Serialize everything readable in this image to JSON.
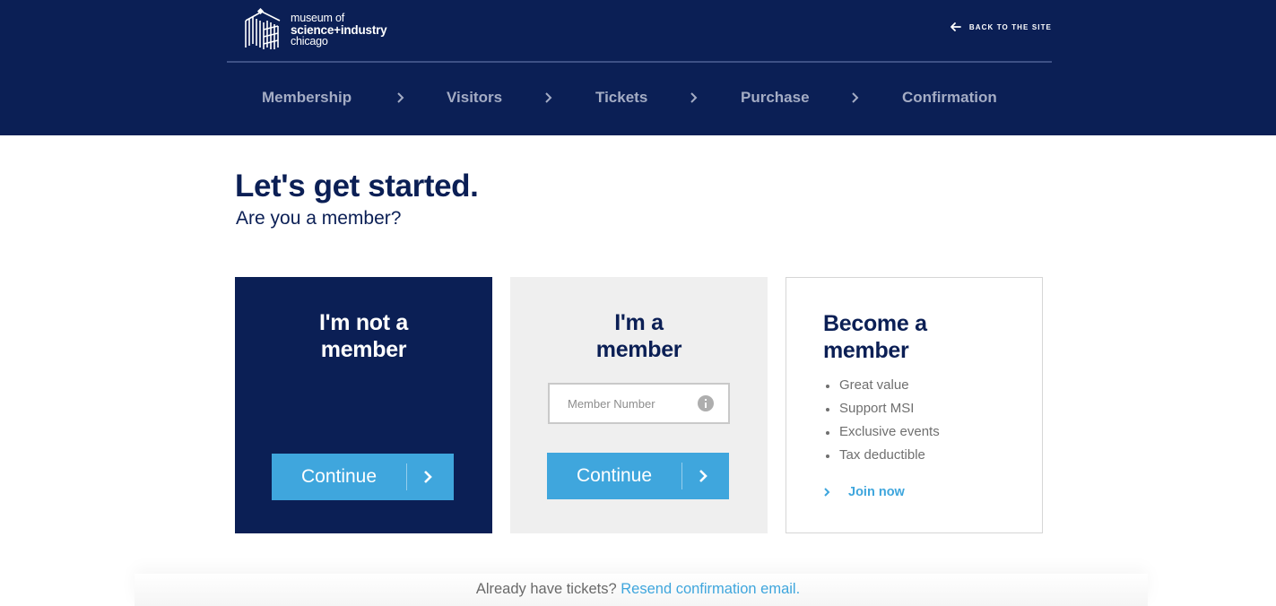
{
  "header": {
    "logo": {
      "line1": "museum of",
      "line2": "science+industry",
      "line3": "chicago"
    },
    "back_link": "BACK TO THE SITE",
    "steps": [
      {
        "label": "Membership"
      },
      {
        "label": "Visitors"
      },
      {
        "label": "Tickets"
      },
      {
        "label": "Purchase"
      },
      {
        "label": "Confirmation"
      }
    ]
  },
  "main": {
    "title": "Let's get started.",
    "subtitle": "Are you a member?"
  },
  "cards": {
    "not_member": {
      "title_line1": "I'm not a",
      "title_line2": "member",
      "button": "Continue"
    },
    "member": {
      "title_line1": "I'm a",
      "title_line2": "member",
      "input_placeholder": "Member Number",
      "input_value": "",
      "button": "Continue"
    },
    "become": {
      "title_line1": "Become a",
      "title_line2": "member",
      "benefits": [
        "Great value",
        "Support MSI",
        "Exclusive events",
        "Tax deductible"
      ],
      "link": "Join now"
    }
  },
  "footer": {
    "text": "Already have tickets?",
    "link": "Resend confirmation email."
  },
  "colors": {
    "navy": "#0b1f55",
    "accent": "#3fa6dd",
    "step_inactive": "#a4acc4",
    "card_gray": "#efefef"
  },
  "icons": {
    "logo": "msi-logo-icon",
    "back": "arrow-left-icon",
    "step_separator": "chevron-right-icon",
    "button": "chevron-right-icon",
    "info": "info-icon"
  }
}
